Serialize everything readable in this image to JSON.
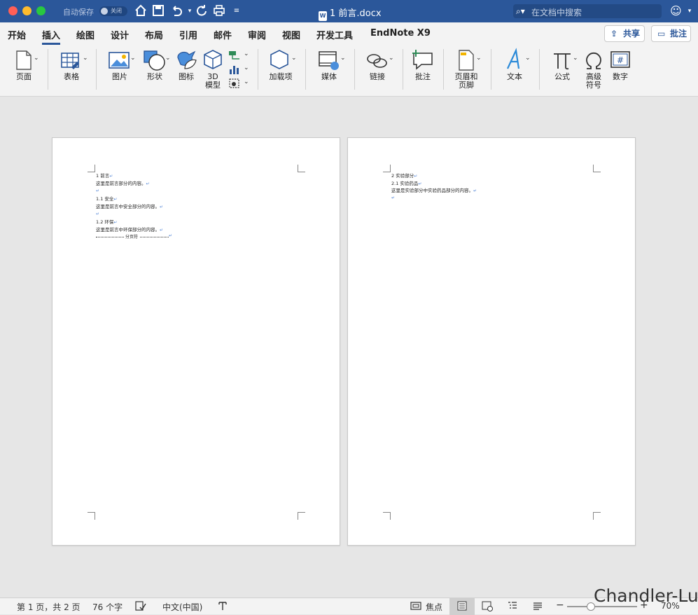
{
  "titlebar": {
    "autosave_label": "自动保存",
    "autosave_state": "关闭",
    "doc_title": "1 前言.docx",
    "search_placeholder": "在文档中搜索",
    "icons": [
      "home-icon",
      "save-icon",
      "undo-icon",
      "redo-icon",
      "print-icon",
      "customize-icon",
      "smiley-icon"
    ]
  },
  "menu": {
    "tabs": [
      "开始",
      "插入",
      "绘图",
      "设计",
      "布局",
      "引用",
      "邮件",
      "审阅",
      "视图",
      "开发工具",
      "EndNote X9"
    ],
    "active_tab": "插入",
    "share_label": "共享",
    "comment_label": "批注"
  },
  "ribbon": {
    "page": "页面",
    "table": "表格",
    "picture": "图片",
    "shapes": "形状",
    "icons": "图标",
    "model_3d_line1": "3D",
    "model_3d_line2": "模型",
    "addins": "加载项",
    "media": "媒体",
    "link": "链接",
    "comment": "批注",
    "header_footer_line1": "页眉和",
    "header_footer_line2": "页脚",
    "text": "文本",
    "equation": "公式",
    "symbol_line1": "高级",
    "symbol_line2": "符号",
    "number": "数字"
  },
  "document": {
    "page1": {
      "lines": [
        {
          "text": "1 前言",
          "mark": "↵"
        },
        {
          "text": "这里是前言部分的内容。",
          "mark": "↵"
        },
        {
          "text": "",
          "mark": "↵"
        },
        {
          "text": "1.1 安全",
          "mark": "↵"
        },
        {
          "text": "这里是前言中安全部分的内容。",
          "mark": "↵"
        },
        {
          "text": "",
          "mark": "↵"
        },
        {
          "text": "1.2 环保",
          "mark": "↵"
        },
        {
          "text": "这里是前言中环保部分的内容。",
          "mark": "↵"
        }
      ],
      "page_break": "分页符"
    },
    "page2": {
      "lines": [
        {
          "text": "2 实验部分",
          "mark": "↵"
        },
        {
          "text": "2.1 实验药品",
          "mark": "↵"
        },
        {
          "text": "这里是实验部分中实验药品部分的内容。",
          "mark": "↵"
        },
        {
          "text": "",
          "mark": "↵"
        }
      ]
    }
  },
  "status": {
    "page_info": "第 1 页，共 2 页",
    "word_count": "76 个字",
    "language": "中文(中国)",
    "focus": "焦点",
    "zoom_minus": "−",
    "zoom_plus": "+",
    "zoom": "70%",
    "zoom_level": 0.7
  },
  "watermark": "Chandler-Lu"
}
